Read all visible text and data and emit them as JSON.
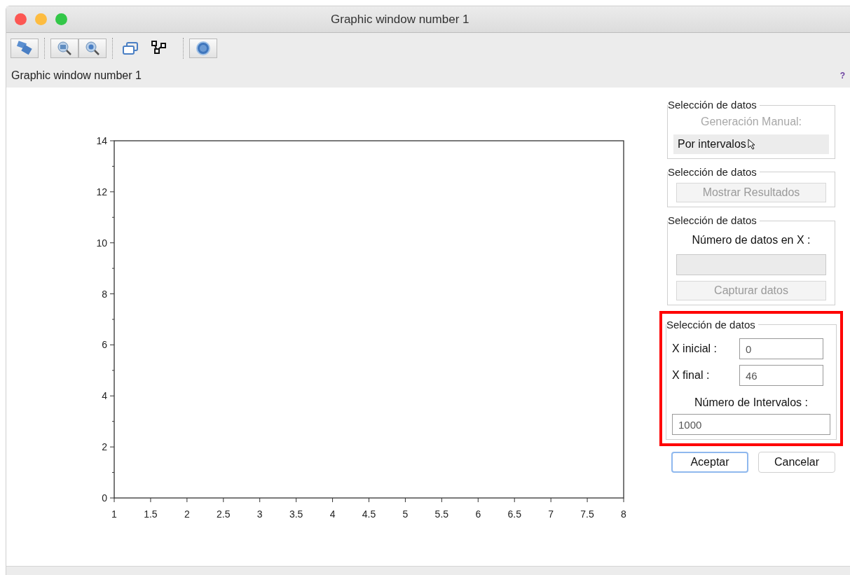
{
  "window": {
    "title": "Graphic window number 1"
  },
  "figure_label": "Graphic window number 1",
  "help_mark": "?",
  "chart_data": {
    "type": "line",
    "xlim": [
      1,
      8
    ],
    "ylim": [
      0,
      14
    ],
    "xticks": [
      1,
      1.5,
      2,
      2.5,
      3,
      3.5,
      4,
      4.5,
      5,
      5.5,
      6,
      6.5,
      7,
      7.5,
      8
    ],
    "yticks": [
      0,
      2,
      4,
      6,
      8,
      10,
      12,
      14
    ]
  },
  "panel": {
    "groups": [
      {
        "kind": "choice",
        "legend": "Selección de datos",
        "heading": "Generación Manual:",
        "heading_disabled": true,
        "option": "Por intervalos"
      },
      {
        "kind": "button",
        "legend": "Selección de datos",
        "button": {
          "label": "Mostrar Resultados",
          "disabled": true
        }
      },
      {
        "kind": "entry",
        "legend": "Selección de datos",
        "label": "Número de datos en X :",
        "field_disabled": true,
        "button": {
          "label": "Capturar datos",
          "disabled": true
        }
      },
      {
        "kind": "form",
        "legend": "Selección de datos",
        "highlighted": true,
        "rows": [
          {
            "label": "X inicial :",
            "value": "0"
          },
          {
            "label": "X final :",
            "value": "46"
          }
        ],
        "label": "Número de Intervalos :",
        "value": "1000"
      }
    ]
  },
  "buttons": [
    {
      "label": "Aceptar",
      "focused": true
    },
    {
      "label": "Cancelar",
      "focused": false
    }
  ]
}
